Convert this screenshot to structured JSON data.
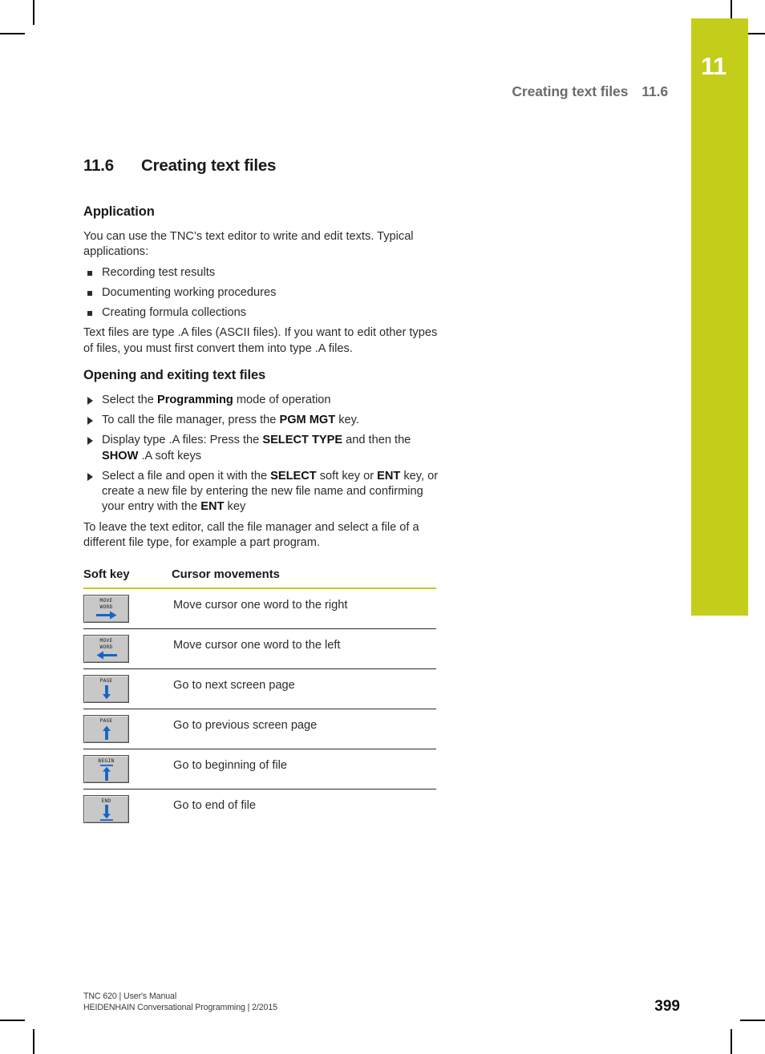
{
  "chapter_tab": {
    "number": "11",
    "color": "#c3cd1a"
  },
  "running_header": {
    "title": "Creating text files",
    "number": "11.6"
  },
  "section": {
    "number": "11.6",
    "title": "Creating text files"
  },
  "application": {
    "heading": "Application",
    "intro": "You can use the TNC’s text editor to write and edit texts. Typical applications:",
    "bullets": [
      "Recording test results",
      "Documenting working procedures",
      "Creating formula collections"
    ],
    "outro": "Text files are type .A files (ASCII files). If you want to edit other types of files, you must first convert them into type .A files."
  },
  "opening": {
    "heading": "Opening and exiting text files",
    "steps": [
      "Select the Programming mode of operation",
      "To call the file manager, press the PGM MGT key.",
      "Display type .A files: Press the SELECT TYPE and then the SHOW .A soft keys",
      "Select a file and open it with the SELECT soft key or ENT key, or create a new file by entering the new file name and confirming your entry with the ENT key"
    ],
    "outro": "To leave the text editor, call the file manager and select a file of a different file type, for example a part program."
  },
  "softkey_table": {
    "headers": {
      "key": "Soft key",
      "description": "Cursor movements"
    },
    "rows": [
      {
        "key_label_line1": "MOVE",
        "key_label_line2": "WORD",
        "icon": "arrow-right-icon",
        "description": "Move cursor one word to the right"
      },
      {
        "key_label_line1": "MOVE",
        "key_label_line2": "WORD",
        "icon": "arrow-left-icon",
        "description": "Move cursor one word to the left"
      },
      {
        "key_label_line1": "PAGE",
        "key_label_line2": "",
        "icon": "arrow-down-icon",
        "description": "Go to next screen page"
      },
      {
        "key_label_line1": "PAGE",
        "key_label_line2": "",
        "icon": "arrow-up-icon",
        "description": "Go to previous screen page"
      },
      {
        "key_label_line1": "BEGIN",
        "key_label_line2": "",
        "icon": "arrow-up-to-line-icon",
        "description": "Go to beginning of file"
      },
      {
        "key_label_line1": "END",
        "key_label_line2": "",
        "icon": "arrow-down-to-line-icon",
        "description": "Go to end of file"
      }
    ]
  },
  "footer": {
    "line1": "TNC 620 | User's Manual",
    "line2": "HEIDENHAIN Conversational Programming | 2/2015",
    "page": "399"
  }
}
